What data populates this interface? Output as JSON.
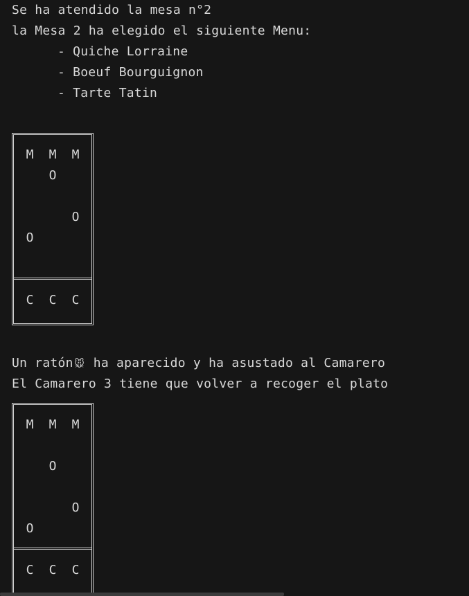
{
  "console": {
    "lines_top": [
      "Se ha atendido la mesa n°2",
      "la Mesa 2 ha elegido el siguiente Menu:"
    ],
    "menu_items": [
      "- Quiche Lorraine",
      "- Boeuf Bourguignon",
      "- Tarte Tatin"
    ],
    "event_line_1_before": "Un ratón",
    "event_line_1_icon": "🐭",
    "event_line_1_after": " ha aparecido y ha asustado al Camarero",
    "event_line_2": "El Camarero 3 tiene que volver a recoger el plato"
  },
  "boards": [
    {
      "mesas": [
        "M",
        "M",
        "M"
      ],
      "clientes": [
        "O",
        "O",
        "O"
      ],
      "camareros": [
        "C",
        "C",
        "C"
      ]
    },
    {
      "mesas": [
        "M",
        "M",
        "M"
      ],
      "clientes": [
        "O",
        "O",
        "O"
      ],
      "camareros": [
        "C",
        "C",
        "C"
      ]
    }
  ],
  "icons": {
    "mouse": "mouse-emoji-icon"
  },
  "colors": {
    "background": "#161616",
    "text": "#d8d8d8",
    "frame": "#cfcfcf"
  }
}
